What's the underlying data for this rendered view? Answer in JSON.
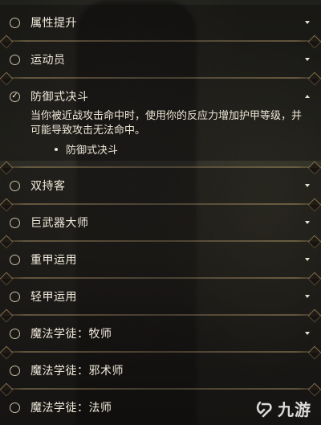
{
  "feats": [
    {
      "label": "属性提升",
      "selected": false,
      "expanded": false
    },
    {
      "label": "运动员",
      "selected": false,
      "expanded": false
    },
    {
      "label": "防御式决斗",
      "selected": true,
      "expanded": true
    },
    {
      "label": "双持客",
      "selected": false,
      "expanded": false
    },
    {
      "label": "巨武器大师",
      "selected": false,
      "expanded": false
    },
    {
      "label": "重甲运用",
      "selected": false,
      "expanded": false
    },
    {
      "label": "轻甲运用",
      "selected": false,
      "expanded": false
    },
    {
      "label": "魔法学徒：牧师",
      "selected": false,
      "expanded": false
    },
    {
      "label": "魔法学徒：邪术师",
      "selected": false,
      "expanded": false
    },
    {
      "label": "魔法学徒：法师",
      "selected": false,
      "expanded": false
    }
  ],
  "expanded_detail": {
    "description": "当你被近战攻击命中时，使用你的反应力增加护甲等级，并可能导致攻击无法命中。",
    "bullet": "防御式决斗"
  },
  "checkmark_glyph": "✓",
  "watermark": {
    "text": "九游",
    "logo_icon": "jiuyou-logo-icon"
  },
  "colors": {
    "text": "#f0e9da",
    "divider_gold": "#967d55",
    "panel": "#0e0d0b"
  }
}
